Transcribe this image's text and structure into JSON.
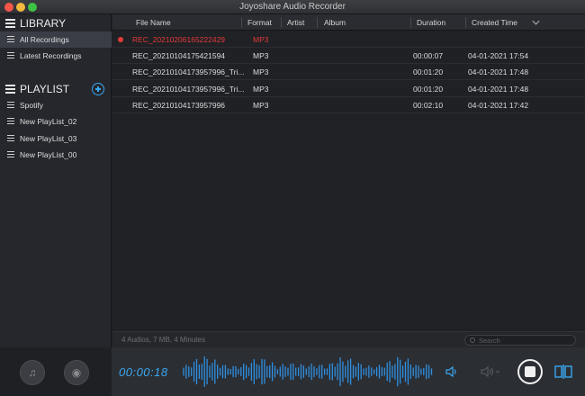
{
  "window": {
    "title": "Joyoshare Audio Recorder"
  },
  "sidebar": {
    "library_label": "LIBRARY",
    "library_items": [
      {
        "label": "All Recordings",
        "active": true
      },
      {
        "label": "Latest Recordings",
        "active": false
      }
    ],
    "playlist_label": "PLAYLIST",
    "playlists": [
      {
        "label": "Spotify"
      },
      {
        "label": "New PlayList_02"
      },
      {
        "label": "New PlayList_03"
      },
      {
        "label": "New PlayList_00"
      }
    ]
  },
  "table": {
    "columns": [
      "File Name",
      "Format",
      "Artist",
      "Album",
      "Duration",
      "Created Time"
    ],
    "rows": [
      {
        "file_name": "REC_20210206165222429",
        "format": "MP3",
        "artist": "",
        "album": "",
        "duration": "",
        "created": "",
        "recording": true
      },
      {
        "file_name": "REC_20210104175421594",
        "format": "MP3",
        "artist": "",
        "album": "",
        "duration": "00:00:07",
        "created": "04-01-2021 17:54",
        "recording": false
      },
      {
        "file_name": "REC_20210104173957996_Tri...",
        "format": "MP3",
        "artist": "",
        "album": "",
        "duration": "00:01:20",
        "created": "04-01-2021 17:48",
        "recording": false
      },
      {
        "file_name": "REC_20210104173957996_Tri...",
        "format": "MP3",
        "artist": "",
        "album": "",
        "duration": "00:01:20",
        "created": "04-01-2021 17:48",
        "recording": false
      },
      {
        "file_name": "REC_20210104173957996",
        "format": "MP3",
        "artist": "",
        "album": "",
        "duration": "00:02:10",
        "created": "04-01-2021 17:42",
        "recording": false
      }
    ]
  },
  "status": {
    "summary": "4 Audios, 7 MB, 4 Minutes",
    "search_placeholder": "Search"
  },
  "player": {
    "elapsed": "00:00:18"
  },
  "colors": {
    "accent": "#3aa7f0",
    "recording": "#e53a3a",
    "background": "#1f2125"
  },
  "icons": [
    "list-icon",
    "add-playlist-icon",
    "music-note-icon",
    "disc-icon",
    "volume-icon",
    "speaker-icon",
    "stop-icon",
    "split-icon",
    "search-icon",
    "sort-chevron-icon"
  ]
}
